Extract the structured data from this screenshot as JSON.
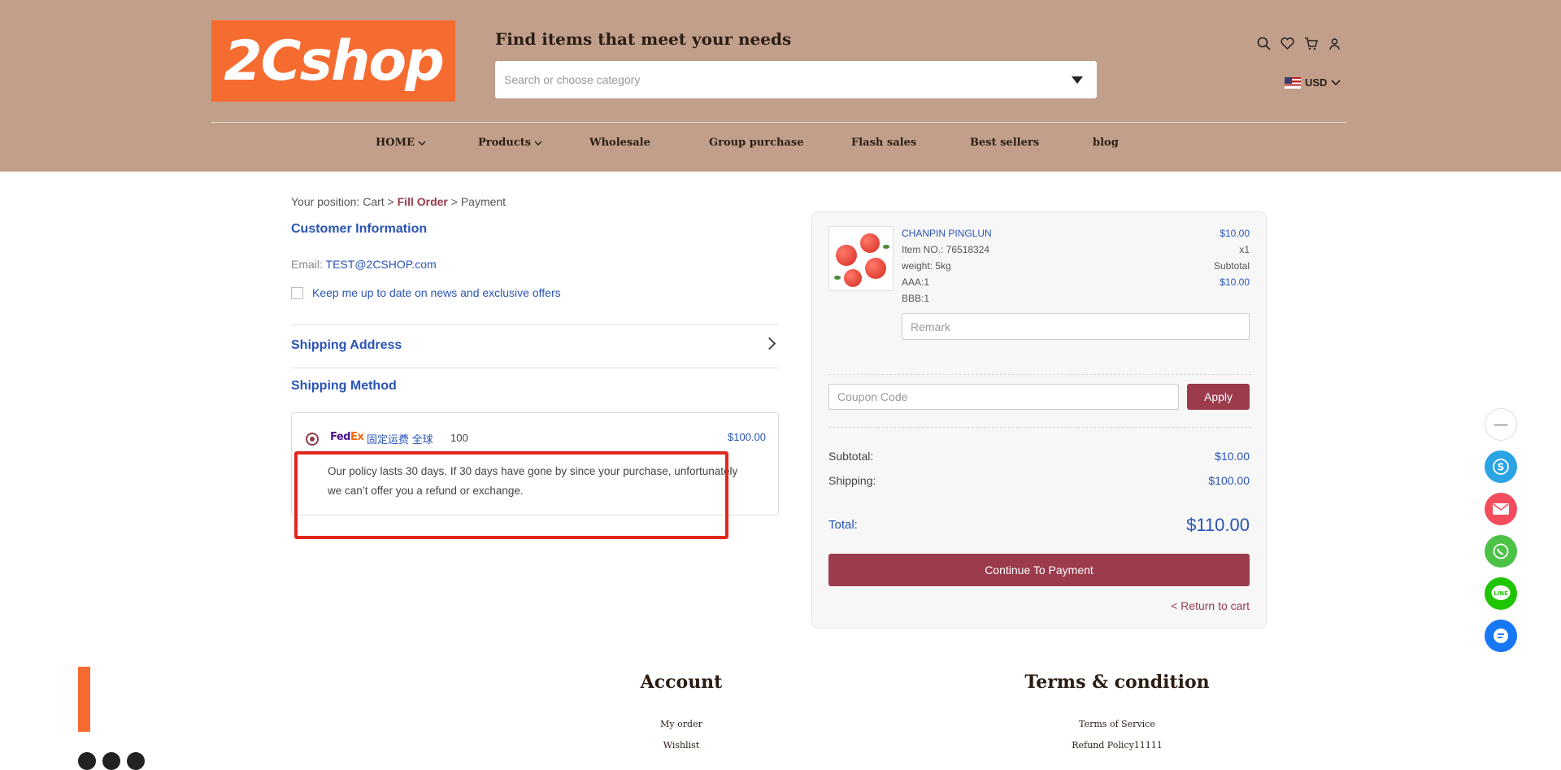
{
  "header": {
    "logo_text": "2Cshop",
    "tagline": "Find items that meet your needs",
    "search_placeholder": "Search or choose category",
    "currency": "USD",
    "icons": [
      "search-icon",
      "heart-icon",
      "cart-icon",
      "user-icon"
    ]
  },
  "nav": [
    {
      "label": "HOME",
      "dropdown": true
    },
    {
      "label": "Products",
      "dropdown": true
    },
    {
      "label": "Wholesale",
      "dropdown": false
    },
    {
      "label": "Group purchase",
      "dropdown": false
    },
    {
      "label": "Flash sales",
      "dropdown": false
    },
    {
      "label": "Best sellers",
      "dropdown": false
    },
    {
      "label": "blog",
      "dropdown": false
    }
  ],
  "breadcrumb": {
    "prefix": "Your position: Cart > ",
    "active": "Fill Order",
    "suffix": " > Payment"
  },
  "customer": {
    "title": "Customer Information",
    "email_label": "Email: ",
    "email_value": "TEST@2CSHOP.com",
    "newsletter_label": "Keep me up to date on news and exclusive offers"
  },
  "shipping_address": {
    "title": "Shipping Address"
  },
  "shipping_method": {
    "title": "Shipping Method",
    "carrier_logo": "FedEx",
    "option_name": "固定运费 全球",
    "option_qty": "100",
    "option_price": "$100.00",
    "policy": "Our policy lasts 30 days. If 30 days have gone by since your purchase, unfortunately we can’t offer you a refund or exchange."
  },
  "order": {
    "product_name": "CHANPIN PINGLUN",
    "item_no": "Item NO.: 76518324",
    "weight": "weight: 5kg",
    "attr1": "AAA:1",
    "attr2": "BBB:1",
    "price": "$10.00",
    "qty": "x1",
    "subtotal_label": "Subtotal",
    "subtotal_value": "$10.00",
    "remark_placeholder": "Remark",
    "coupon_placeholder": "Coupon Code",
    "apply_label": "Apply",
    "sum_subtotal_label": "Subtotal:",
    "sum_subtotal_value": "$10.00",
    "sum_shipping_label": "Shipping:",
    "sum_shipping_value": "$100.00",
    "total_label": "Total:",
    "total_value": "$110.00",
    "pay_label": "Continue To Payment",
    "return_label": "< Return to cart"
  },
  "floating": {
    "minus": "—",
    "buttons": [
      {
        "name": "skype-icon",
        "color": "#2aa4e4",
        "glyph": "S"
      },
      {
        "name": "email-icon",
        "color": "#f24c5d",
        "glyph": "✉"
      },
      {
        "name": "whatsapp-icon",
        "color": "#4cc247",
        "glyph": "✆"
      },
      {
        "name": "line-icon",
        "color": "#1fc500",
        "glyph": "LINE"
      },
      {
        "name": "messenger-icon",
        "color": "#1877f2",
        "glyph": "≡"
      }
    ]
  },
  "footer": {
    "account_title": "Account",
    "account_links": [
      "My order",
      "Wishlist"
    ],
    "terms_title": "Terms & condition",
    "terms_links": [
      "Terms of Service",
      "Refund Policy11111"
    ]
  }
}
